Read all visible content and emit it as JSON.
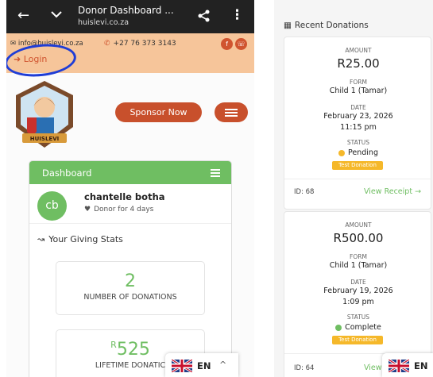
{
  "left": {
    "appbar": {
      "title": "Donor Dashboard ...",
      "url": "huislevi.co.za",
      "back_icon": "arrow-left-icon",
      "collapse_icon": "chevron-down-icon",
      "share_icon": "share-icon",
      "more_icon": "more-vertical-icon"
    },
    "contact": {
      "email": "info@huislevi.co.za",
      "phone": "+27 76 373 3143",
      "login": "Login"
    },
    "header": {
      "sponsor": "Sponsor Now",
      "logo_text": "HUISLEVI"
    },
    "dashboard": {
      "title": "Dashboard",
      "avatar_initials": "cb",
      "name": "chantelle botha",
      "subtitle": "Donor for 4 days",
      "giving_stats": "Your Giving Stats",
      "stats": [
        {
          "value": "2",
          "caption": "NUMBER OF DONATIONS"
        },
        {
          "currency": "R",
          "value": "525",
          "caption": "LIFETIME DONATIC"
        }
      ]
    },
    "lang": {
      "code": "EN",
      "chevron": "^"
    }
  },
  "right": {
    "heading": "Recent Donations",
    "donations": [
      {
        "amount_label": "AMOUNT",
        "amount": "R25.00",
        "form_label": "FORM",
        "form": "Child 1 (Tamar)",
        "date_label": "DATE",
        "date": "February 23, 2026",
        "time": "11:15 pm",
        "status_label": "STATUS",
        "status": "Pending",
        "tag": "Test Donation",
        "id": "ID: 68",
        "link": "View Receipt →"
      },
      {
        "amount_label": "AMOUNT",
        "amount": "R500.00",
        "form_label": "FORM",
        "form": "Child 1 (Tamar)",
        "date_label": "DATE",
        "date": "February 19, 2026",
        "time": "1:09 pm",
        "status_label": "STATUS",
        "status": "Complete",
        "tag": "Test Donation",
        "id": "ID: 64",
        "link": "View R"
      }
    ],
    "lang": {
      "code": "EN",
      "chevron": "^"
    }
  },
  "colors": {
    "accent_orange": "#c8502c",
    "green": "#6fbe62",
    "pending": "#f5b82a",
    "complete": "#6fbe62",
    "contact_bar": "#f6c59a",
    "appbar": "#222222"
  }
}
